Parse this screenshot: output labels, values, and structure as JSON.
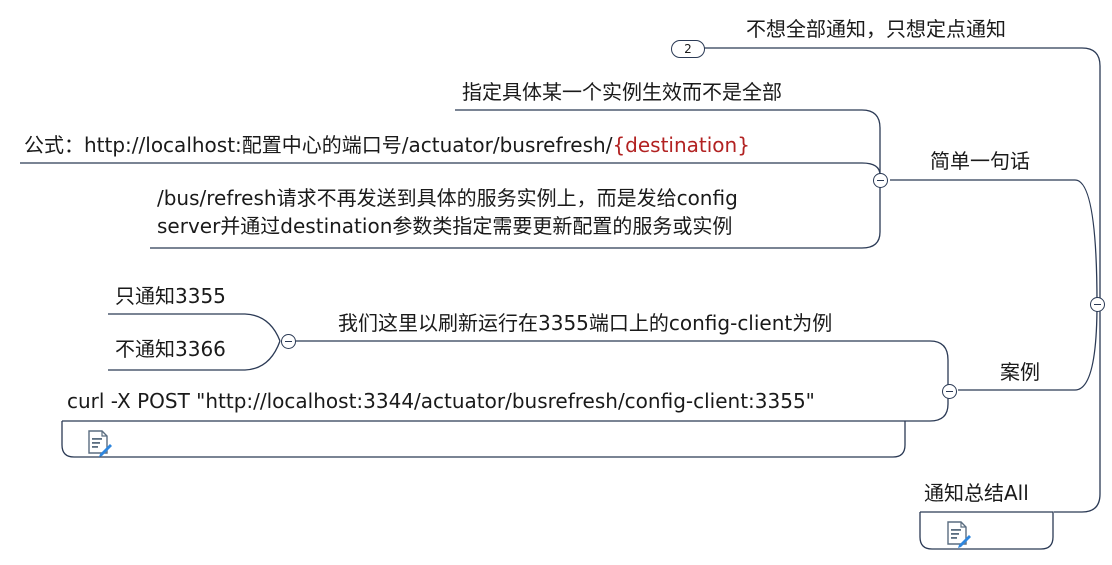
{
  "colors": {
    "line": "#2b3a55",
    "highlight": "#b22222"
  },
  "topics": {
    "notify_summary": "通知总结All",
    "simple_summary": "简单一句话",
    "case": "案例"
  },
  "nodes": {
    "no_full_notify": "不想全部通知，只想定点通知",
    "collapsed_count": "2",
    "specific_instance": "指定具体某一个实例生效而不是全部",
    "formula_prefix": "公式：http://localhost:配置中心的端口号/actuator/busrefresh/",
    "formula_destination": "{destination}",
    "explanation": "/bus/refresh请求不再发送到具体的服务实例上，而是发给config\nserver并通过destination参数类指定需要更新配置的服务或实例",
    "example_refresh": "我们这里以刷新运行在3355端口上的config-client为例",
    "notify_3355": "只通知3355",
    "not_notify_3366": "不通知3366",
    "curl_command": "curl -X POST \"http://localhost:3344/actuator/busrefresh/config-client:3355\""
  },
  "icons": [
    "note-icon",
    "note-icon"
  ]
}
